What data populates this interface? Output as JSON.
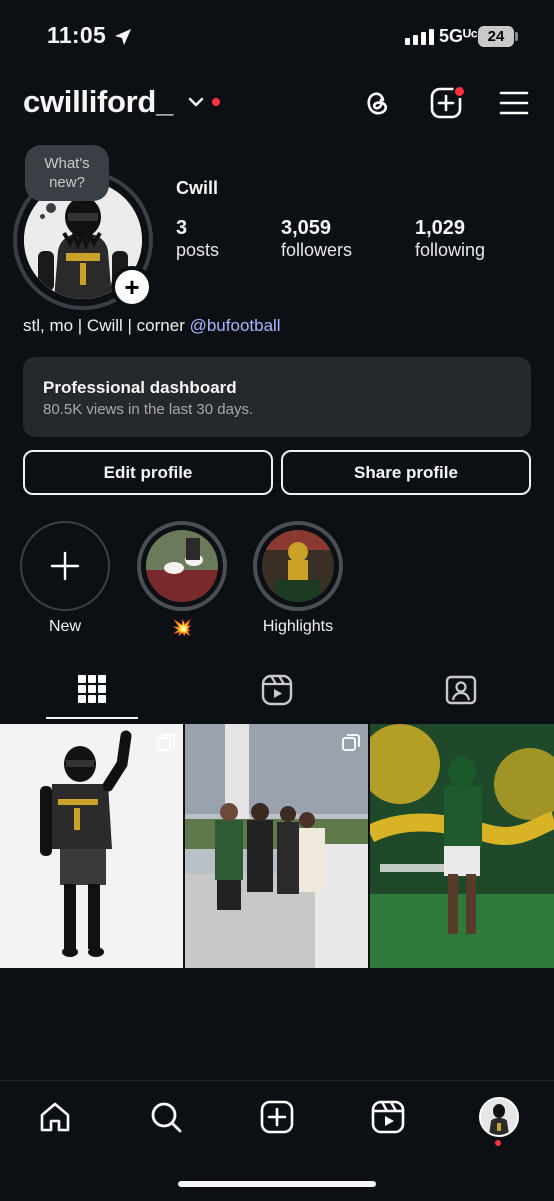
{
  "status_bar": {
    "time": "11:05",
    "network": "5Gᵁᶜ",
    "battery": "24"
  },
  "header": {
    "username": "cwilliford_",
    "icons": [
      "chevron-down-icon",
      "threads-icon",
      "create-icon",
      "menu-icon"
    ]
  },
  "profile": {
    "note_text": "What's new?",
    "display_name": "Cwill",
    "stats": [
      {
        "value": "3",
        "label": "posts"
      },
      {
        "value": "3,059",
        "label": "followers"
      },
      {
        "value": "1,029",
        "label": "following"
      }
    ],
    "bio_text": "stl, mo | Cwill | corner ",
    "bio_link": "@bufootball"
  },
  "dashboard": {
    "title": "Professional dashboard",
    "subtitle": "80.5K views in the last 30 days."
  },
  "buttons": {
    "edit": "Edit profile",
    "share": "Share profile"
  },
  "highlights": [
    {
      "label": "New"
    },
    {
      "label": "💥"
    },
    {
      "label": "Highlights"
    }
  ],
  "tabs": [
    "grid-icon",
    "reels-icon",
    "tagged-icon"
  ],
  "bottom_nav": [
    "home-icon",
    "search-icon",
    "create-icon",
    "reels-icon",
    "profile-avatar"
  ],
  "colors": {
    "background": "#0c1014",
    "link": "#a7b5ff",
    "notification": "#ff3040",
    "card": "#25292e"
  }
}
